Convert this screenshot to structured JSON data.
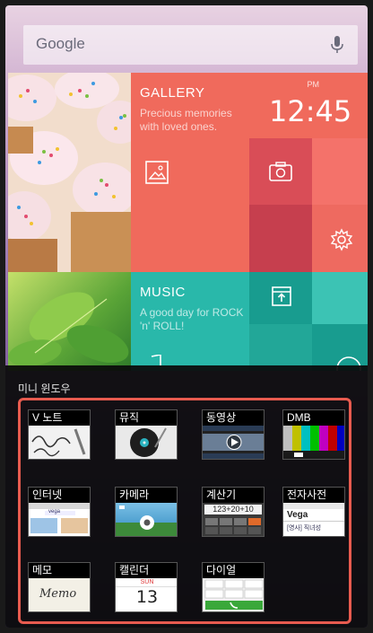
{
  "search": {
    "label": "Google",
    "icon": "mic-icon"
  },
  "gallery": {
    "title": "GALLERY",
    "subtitle": "Precious memories with loved ones."
  },
  "clock": {
    "ampm": "PM",
    "time": "12:45"
  },
  "music": {
    "title": "MUSIC",
    "subtitle": "A good day for ROCK 'n' ROLL!"
  },
  "mini_window": {
    "title": "미니 윈도우",
    "apps": [
      {
        "name": "V 노트",
        "icon": "handwriting-note-icon",
        "thumb_text": ""
      },
      {
        "name": "뮤직",
        "icon": "vinyl-record-icon",
        "thumb_text": ""
      },
      {
        "name": "동영상",
        "icon": "video-play-icon",
        "thumb_text": ""
      },
      {
        "name": "DMB",
        "icon": "tv-color-bars-icon",
        "thumb_text": ""
      },
      {
        "name": "인터넷",
        "icon": "browser-icon",
        "thumb_text": "vega"
      },
      {
        "name": "카메라",
        "icon": "camera-icon",
        "thumb_text": ""
      },
      {
        "name": "계산기",
        "icon": "calculator-icon",
        "thumb_text": "123+20+10"
      },
      {
        "name": "전자사전",
        "icon": "dictionary-icon",
        "thumb_text": "Vega"
      },
      {
        "name": "메모",
        "icon": "memo-icon",
        "thumb_text": "Memo"
      },
      {
        "name": "캘린더",
        "icon": "calendar-icon",
        "thumb_text": "13"
      },
      {
        "name": "다이얼",
        "icon": "dialpad-icon",
        "thumb_text": ""
      }
    ],
    "calendar_day": "SUN",
    "dictionary_sub": "[영사] 직녀성"
  },
  "colors": {
    "accent": "#e85b4f",
    "coral": "#f06a5c",
    "teal": "#29b8aa"
  }
}
